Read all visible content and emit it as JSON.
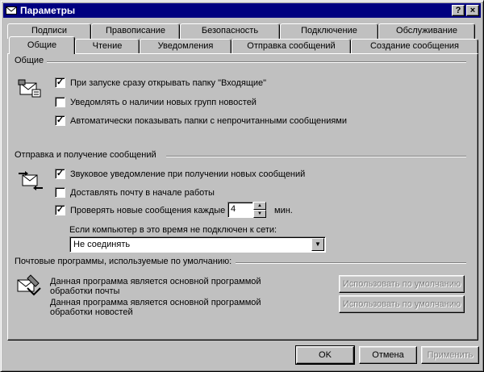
{
  "window": {
    "title": "Параметры",
    "help_label": "?",
    "close_label": "×"
  },
  "tabs": {
    "row_back": [
      "Подписи",
      "Правописание",
      "Безопасность",
      "Подключение",
      "Обслуживание"
    ],
    "row_front": [
      "Общие",
      "Чтение",
      "Уведомления",
      "Отправка сообщений",
      "Создание сообщения"
    ],
    "active": "Общие"
  },
  "general": {
    "title": "Общие",
    "icon": "mail-envelope-icon",
    "options": [
      {
        "label": "При запуске сразу открывать папку \"Входящие\"",
        "checked": true
      },
      {
        "label": "Уведомлять о наличии новых групп новостей",
        "checked": false
      },
      {
        "label": "Автоматически показывать папки с непрочитанными сообщениями",
        "checked": true
      }
    ]
  },
  "send_receive": {
    "title": "Отправка и получение сообщений",
    "icon": "send-receive-icon",
    "options": [
      {
        "label": "Звуковое уведомление при получении новых сообщений",
        "checked": true
      },
      {
        "label": "Доставлять почту в начале работы",
        "checked": false
      },
      {
        "label": "Проверять новые сообщения каждые",
        "checked": true
      }
    ],
    "interval_value": "4",
    "interval_unit": "мин.",
    "offline_label": "Если компьютер в это время не подключен к сети:",
    "offline_value": "Не соединять"
  },
  "default_programs": {
    "title": "Почтовые программы, используемые по умолчанию:",
    "icon": "default-program-icon",
    "mail_text": "Данная программа является основной программой обработки почты",
    "news_text": "Данная программа является основной программой обработки новостей",
    "use_default_label": "Использовать по умолчанию"
  },
  "buttons": {
    "ok": "OK",
    "cancel": "Отмена",
    "apply": "Применить"
  },
  "colors": {
    "face": "#c0c0c0",
    "titlebar": "#000080",
    "disabled_text": "#808080"
  }
}
